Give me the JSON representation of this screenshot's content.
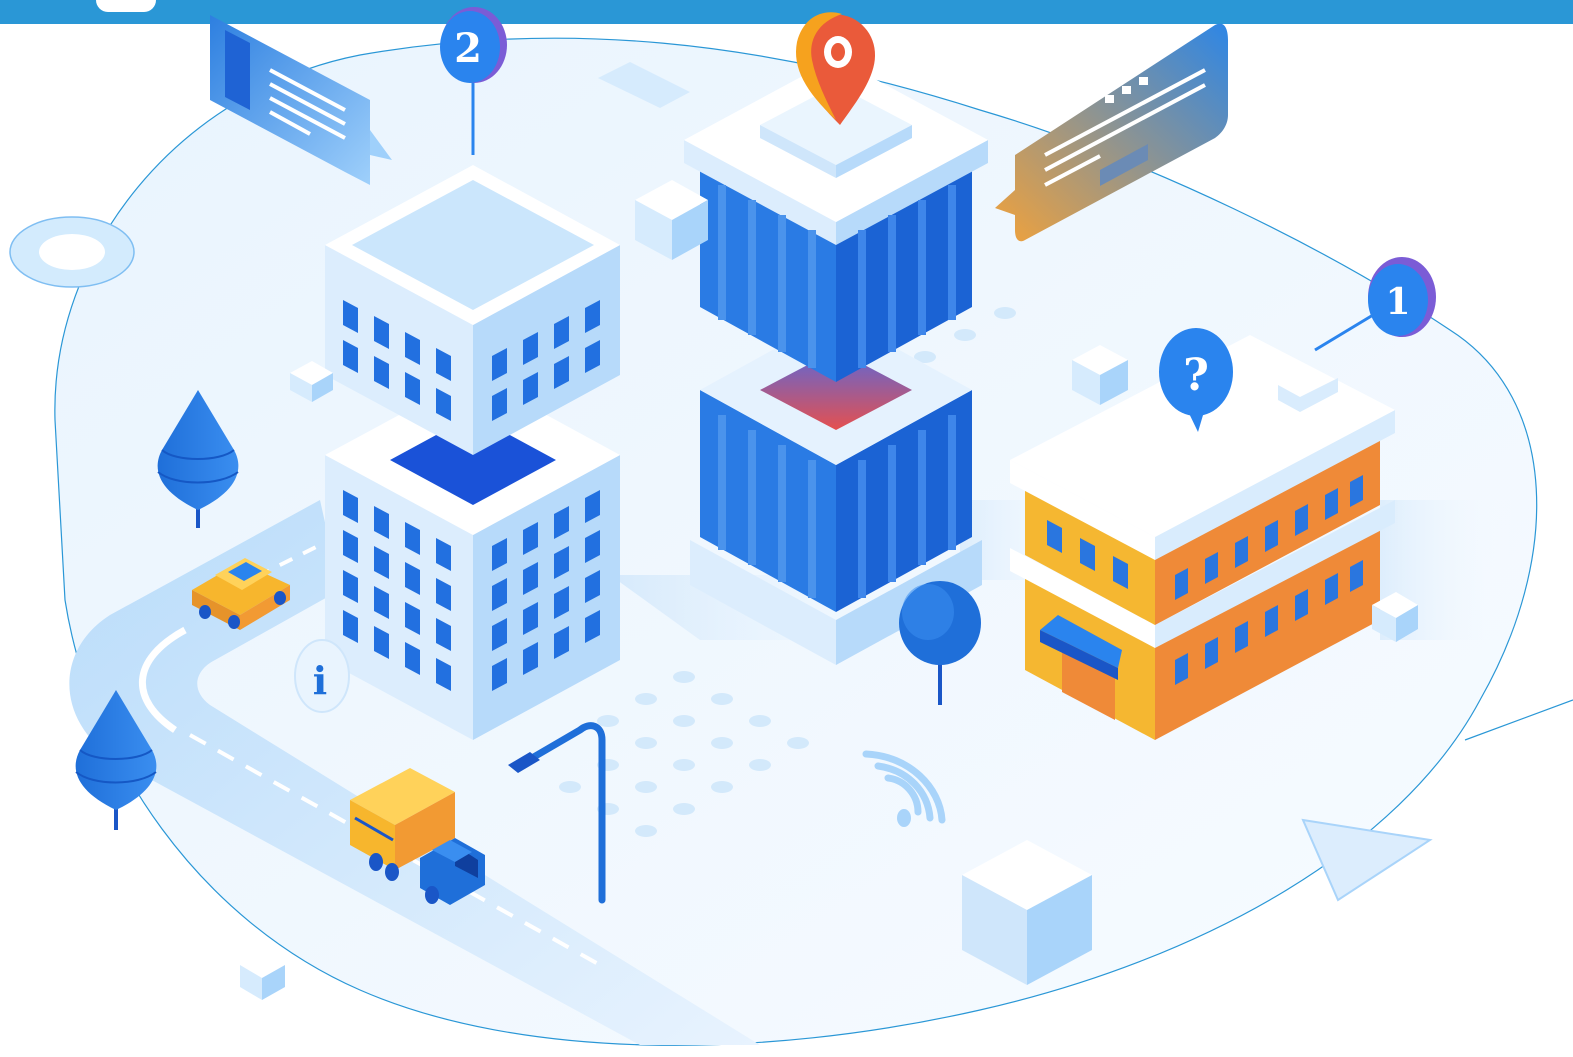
{
  "markers": {
    "badge_two": "2",
    "badge_one": "1",
    "help_glyph": "?",
    "info_glyph": "i"
  },
  "icons": [
    "map-pin-icon",
    "info-icon",
    "question-icon",
    "wifi-icon",
    "play-icon",
    "chat-bubble-icon"
  ],
  "colors": {
    "topbar": "#2a97d6",
    "accent_blue": "#1f6fd9",
    "light_blue": "#cfe6fb",
    "pale_blue": "#eef6fe",
    "orange": "#f28c3a",
    "yellow": "#f7c23a",
    "pin_red": "#ea5a3a"
  }
}
